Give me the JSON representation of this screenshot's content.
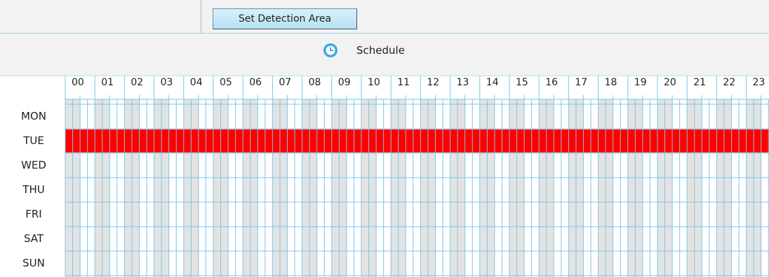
{
  "toolbar": {
    "set_detection_area_label": "Set Detection Area"
  },
  "schedule": {
    "title": "Schedule",
    "icon": "clock-icon",
    "hours": [
      "00",
      "01",
      "02",
      "03",
      "04",
      "05",
      "06",
      "07",
      "08",
      "09",
      "10",
      "11",
      "12",
      "13",
      "14",
      "15",
      "16",
      "17",
      "18",
      "19",
      "20",
      "21",
      "22",
      "23"
    ],
    "days": [
      {
        "label": "MON",
        "selected_fraction": 0
      },
      {
        "label": "TUE",
        "selected_fraction": 1
      },
      {
        "label": "WED",
        "selected_fraction": 0
      },
      {
        "label": "THU",
        "selected_fraction": 0
      },
      {
        "label": "FRI",
        "selected_fraction": 0
      },
      {
        "label": "SAT",
        "selected_fraction": 0
      },
      {
        "label": "SUN",
        "selected_fraction": 0
      }
    ]
  },
  "colors": {
    "grid_line": "#7fc6e4",
    "shaded_half_hour": "#e3e3e3",
    "selected": "#ff0000",
    "header_bg": "#f2f2f2",
    "accent_icon": "#3fa9e0"
  }
}
